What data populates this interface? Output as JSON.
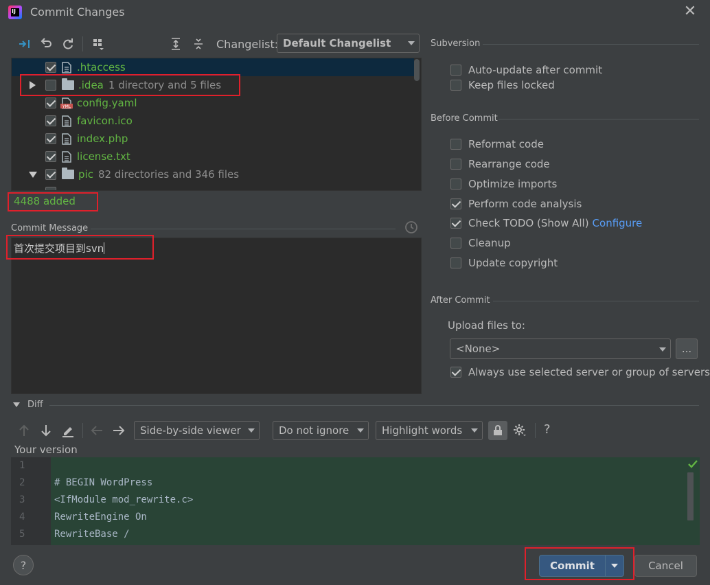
{
  "window": {
    "title": "Commit Changes"
  },
  "toolbar": {
    "changelist_label": "Changelist:",
    "changelist_value": "Default Changelist"
  },
  "tree": {
    "rows": [
      {
        "name": ".htaccess",
        "extra": "",
        "checked": true,
        "kind": "file"
      },
      {
        "name": ".idea",
        "extra": "1 directory and 5 files",
        "checked": false,
        "kind": "folder"
      },
      {
        "name": "config.yaml",
        "extra": "",
        "checked": true,
        "kind": "yaml"
      },
      {
        "name": "favicon.ico",
        "extra": "",
        "checked": true,
        "kind": "file"
      },
      {
        "name": "index.php",
        "extra": "",
        "checked": true,
        "kind": "file"
      },
      {
        "name": "license.txt",
        "extra": "",
        "checked": true,
        "kind": "file"
      },
      {
        "name": "pic",
        "extra": "82 directories and 346 files",
        "checked": true,
        "kind": "folder"
      }
    ],
    "status": "4488 added"
  },
  "commit_message": {
    "label": "Commit Message",
    "text": "首次提交项目到svn"
  },
  "subversion": {
    "label": "Subversion",
    "options": [
      {
        "label": "Auto-update after commit",
        "checked": false
      },
      {
        "label": "Keep files locked",
        "checked": false
      }
    ]
  },
  "before_commit": {
    "label": "Before Commit",
    "options": [
      {
        "label": "Reformat code",
        "checked": false
      },
      {
        "label": "Rearrange code",
        "checked": false
      },
      {
        "label": "Optimize imports",
        "checked": false
      },
      {
        "label": "Perform code analysis",
        "checked": true
      },
      {
        "label": "Check TODO (Show All)",
        "checked": true,
        "link": "Configure"
      },
      {
        "label": "Cleanup",
        "checked": false
      },
      {
        "label": "Update copyright",
        "checked": false
      }
    ]
  },
  "after_commit": {
    "label": "After Commit",
    "upload_label": "Upload files to:",
    "upload_value": "<None>",
    "browse": "...",
    "always_label": "Always use selected server or group of servers",
    "always_checked": true
  },
  "diff": {
    "label": "Diff",
    "viewer": "Side-by-side viewer",
    "ignore": "Do not ignore",
    "highlight": "Highlight words",
    "help": "?",
    "version_label": "Your version",
    "lines": [
      {
        "num": "1",
        "text": ""
      },
      {
        "num": "2",
        "text": "# BEGIN WordPress"
      },
      {
        "num": "3",
        "text": "<IfModule mod_rewrite.c>"
      },
      {
        "num": "4",
        "text": "RewriteEngine On"
      },
      {
        "num": "5",
        "text": "RewriteBase /"
      }
    ]
  },
  "footer": {
    "help": "?",
    "commit": "Commit",
    "cancel": "Cancel"
  },
  "colors": {
    "bg": "#3c3f41",
    "panel": "#2b2b2b",
    "added": "#294436",
    "accent": "#365880",
    "highlight": "#e0202b"
  }
}
